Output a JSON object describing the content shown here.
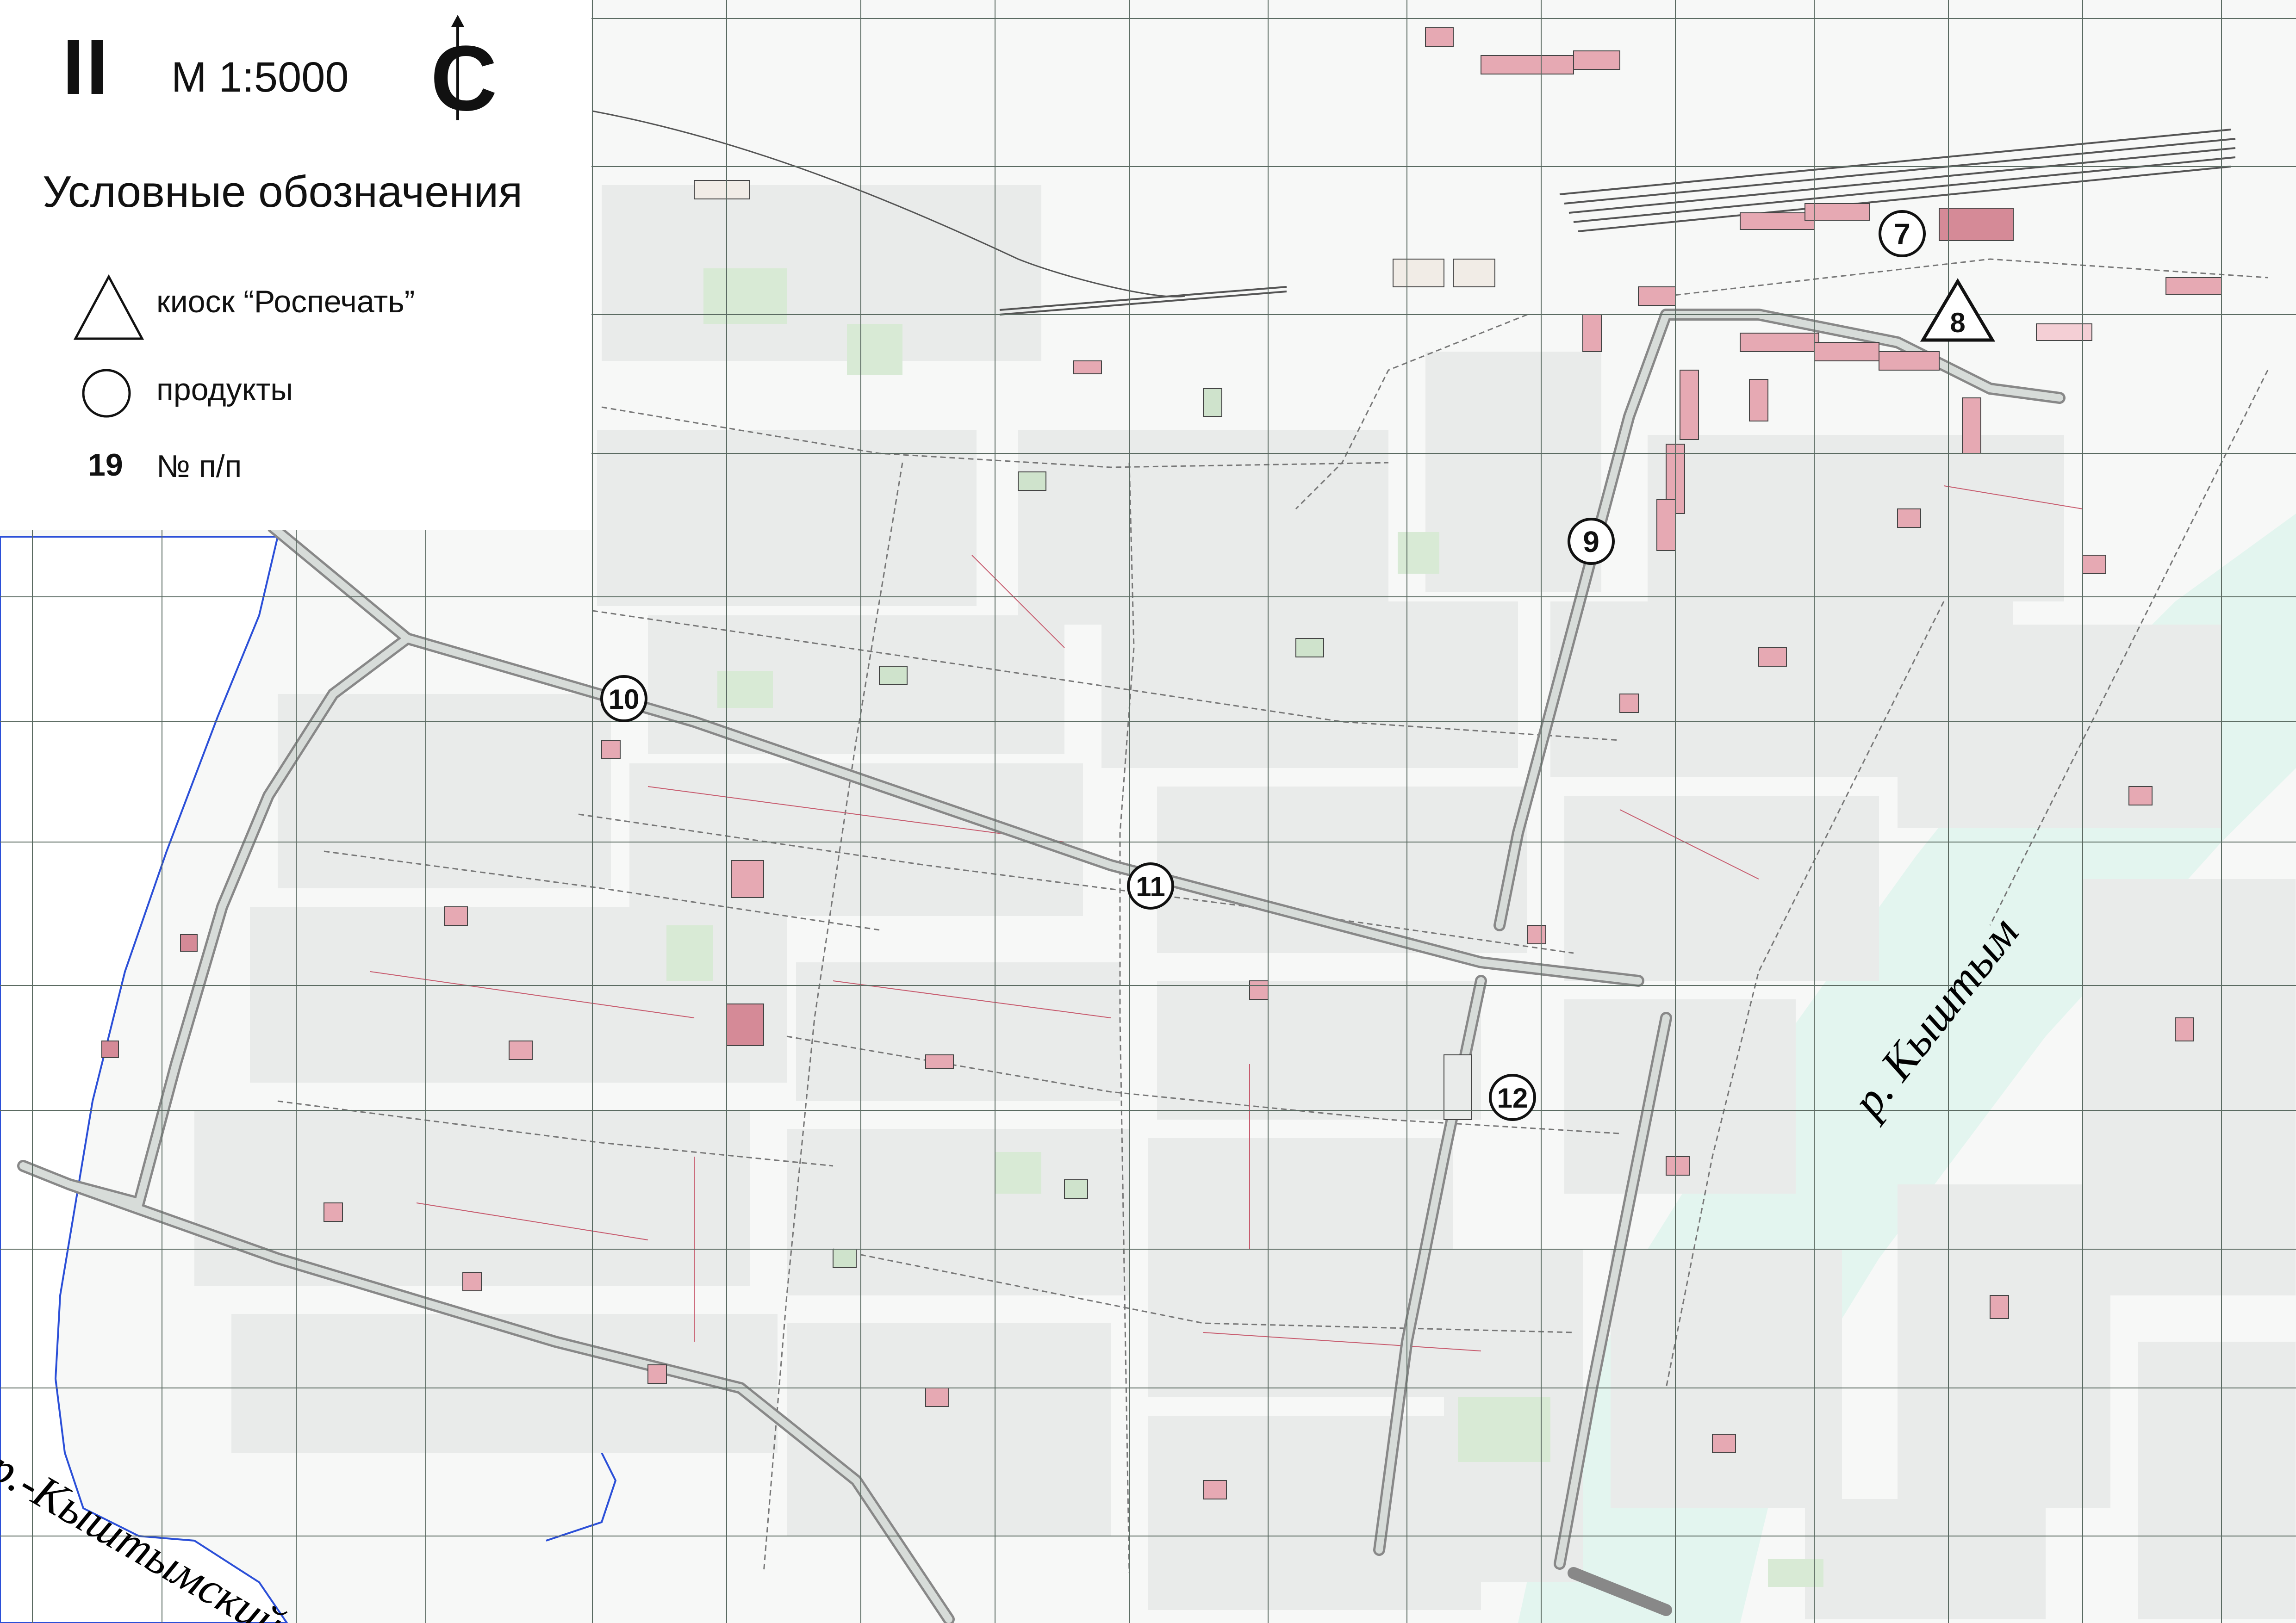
{
  "sheet_number": "II",
  "scale": "М 1:5000",
  "north_label": "С",
  "legend": {
    "title": "Условные обозначения",
    "items": [
      {
        "symbol": "triangle-icon",
        "label": "киоск “Роспечать”"
      },
      {
        "symbol": "circle-icon",
        "label": "продукты"
      },
      {
        "symbol": "number",
        "number": "19",
        "label": "№ п/п"
      }
    ]
  },
  "rivers": [
    "р. Кыштым",
    "р.-Кыштымский"
  ],
  "markers": [
    {
      "number": "7",
      "type": "circle"
    },
    {
      "number": "8",
      "type": "triangle"
    },
    {
      "number": "9",
      "type": "circle"
    },
    {
      "number": "10",
      "type": "circle"
    },
    {
      "number": "11",
      "type": "circle"
    },
    {
      "number": "12",
      "type": "circle"
    }
  ],
  "colors": {
    "background": "#f7f8f7",
    "block": "#e9ebea",
    "building_pink": "#e6a9b3",
    "building_green": "#cfe3cc",
    "water": "#e3f5ef",
    "grid": "#5b6b62",
    "river_label": "#1f4fd0",
    "lake_shore": "#2b4fd8"
  }
}
